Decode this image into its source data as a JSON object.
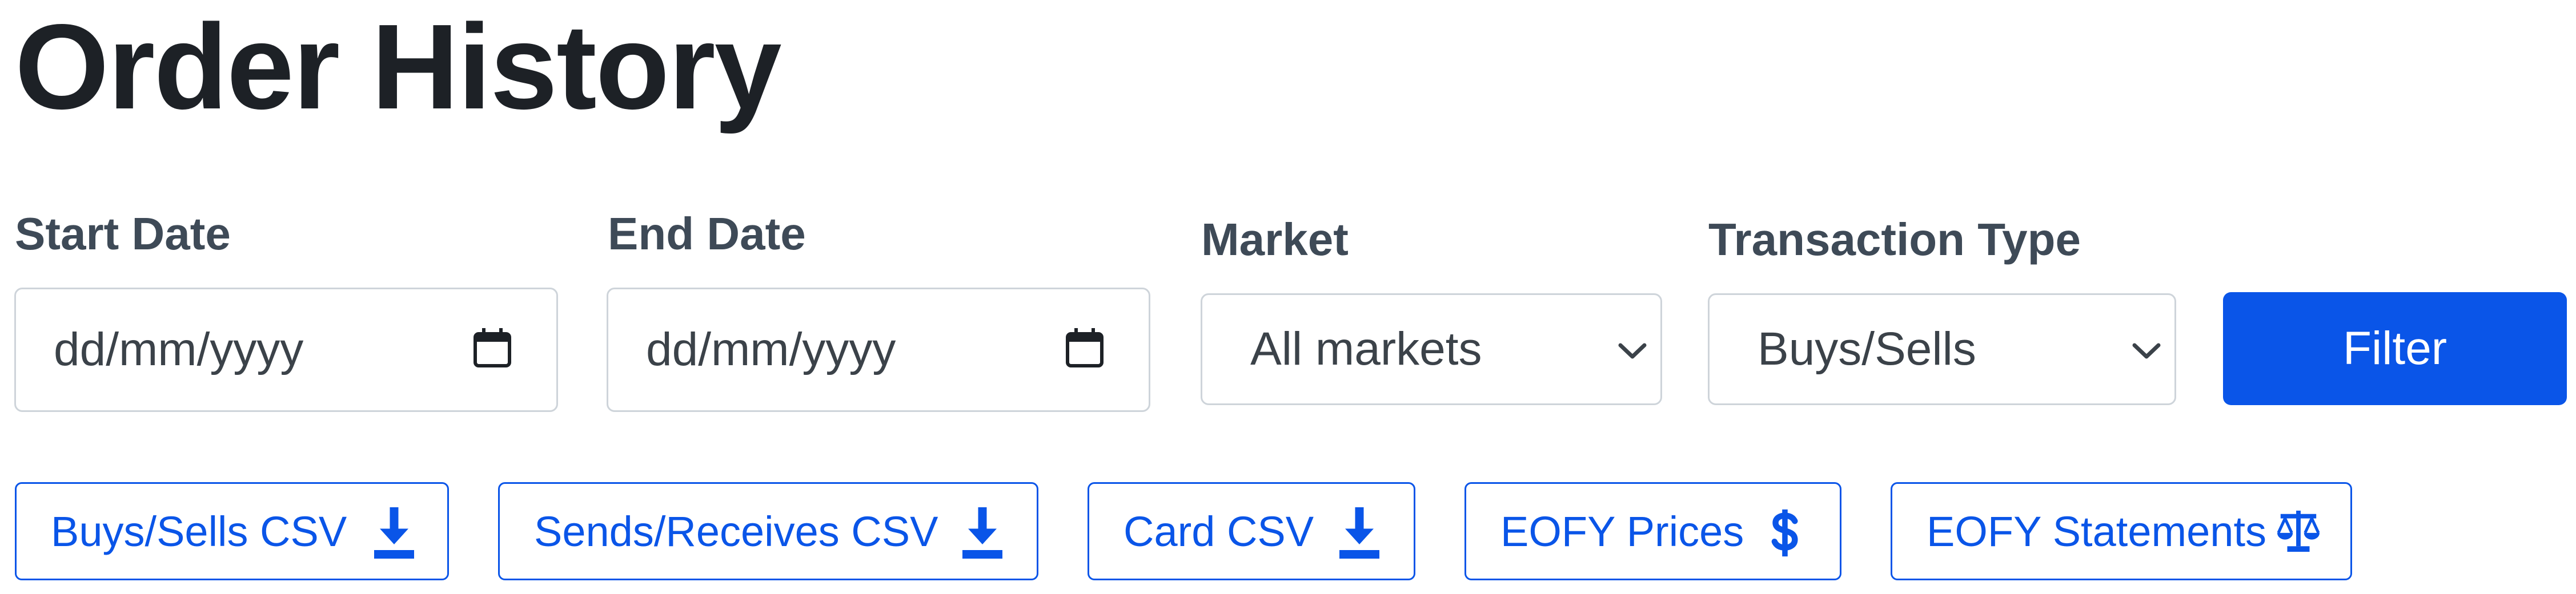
{
  "page": {
    "title": "Order History"
  },
  "filters": {
    "start_date": {
      "label": "Start Date",
      "placeholder": "dd/mm/yyyy",
      "icon": "calendar-icon"
    },
    "end_date": {
      "label": "End Date",
      "placeholder": "dd/mm/yyyy",
      "icon": "calendar-icon"
    },
    "market": {
      "label": "Market",
      "selected": "All markets",
      "icon": "chevron-down-icon"
    },
    "transaction_type": {
      "label": "Transaction Type",
      "selected": "Buys/Sells",
      "icon": "chevron-down-icon"
    },
    "filter_button_label": "Filter"
  },
  "exports": {
    "buys_sells_csv": {
      "label": "Buys/Sells CSV",
      "icon": "download-icon"
    },
    "sends_receives_csv": {
      "label": "Sends/Receives CSV",
      "icon": "download-icon"
    },
    "card_csv": {
      "label": "Card CSV",
      "icon": "download-icon"
    },
    "eofy_prices": {
      "label": "EOFY Prices",
      "icon": "dollar-icon"
    },
    "eofy_statements": {
      "label": "EOFY Statements",
      "icon": "scales-icon"
    }
  },
  "colors": {
    "primary": "#0a55e8",
    "heading": "#1d2126",
    "label": "#3e4a57",
    "input_border": "#ced4da"
  }
}
